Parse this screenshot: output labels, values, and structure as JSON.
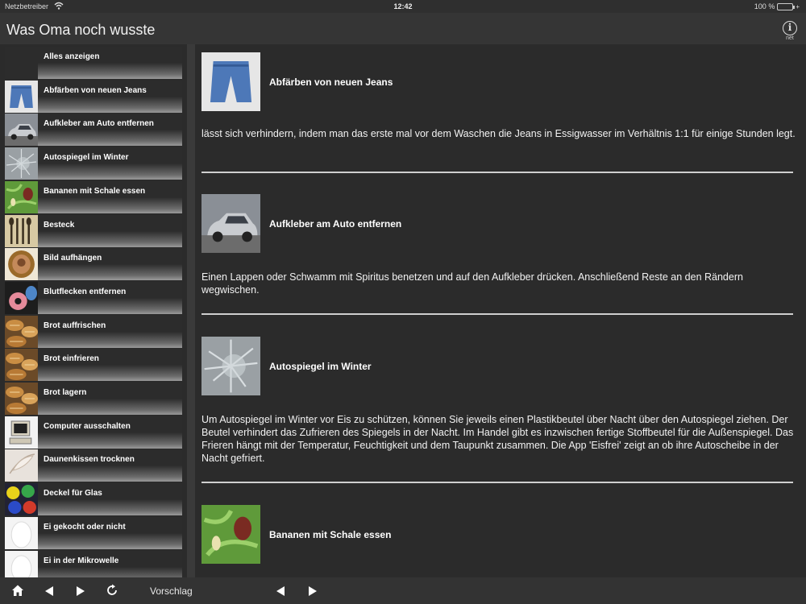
{
  "status": {
    "carrier": "Netzbetreiber",
    "time": "12:42",
    "battery": "100 %"
  },
  "header": {
    "title": "Was Oma noch wusste",
    "info_label": "net"
  },
  "sidebar": {
    "items": [
      {
        "label": "Alles anzeigen",
        "icon": "none"
      },
      {
        "label": "Abfärben von neuen Jeans",
        "icon": "jeans-photo"
      },
      {
        "label": "Aufkleber am Auto entfernen",
        "icon": "car-photo"
      },
      {
        "label": "Autospiegel im Winter",
        "icon": "frost-photo"
      },
      {
        "label": "Bananen mit Schale essen",
        "icon": "banana-photo"
      },
      {
        "label": "Besteck",
        "icon": "cutlery-photo"
      },
      {
        "label": "Bild aufhängen",
        "icon": "picture-frame-photo"
      },
      {
        "label": "Blutflecken entfernen",
        "icon": "sponge-photo"
      },
      {
        "label": "Brot auffrischen",
        "icon": "bread-photo"
      },
      {
        "label": "Brot einfrieren",
        "icon": "bread-photo"
      },
      {
        "label": "Brot lagern",
        "icon": "bread-photo"
      },
      {
        "label": "Computer ausschalten",
        "icon": "computer-photo"
      },
      {
        "label": "Daunenkissen trocknen",
        "icon": "feather-photo"
      },
      {
        "label": "Deckel für Glas",
        "icon": "glass-balls-photo"
      },
      {
        "label": "Ei gekocht oder nicht",
        "icon": "egg-photo"
      },
      {
        "label": "Ei in der Mikrowelle",
        "icon": "egg-photo"
      }
    ]
  },
  "main": {
    "entries": [
      {
        "title": "Abfärben von neuen Jeans",
        "image": "jeans-photo",
        "text": "lässt sich verhindern, indem man das erste mal vor dem Waschen die Jeans in Essigwasser im Verhältnis 1:1 für einige Stunden legt."
      },
      {
        "title": "Aufkleber am Auto entfernen",
        "image": "car-photo",
        "text": "Einen Lappen oder Schwamm mit Spiritus benetzen und auf den Aufkleber drücken. Anschließend Reste an den Rändern wegwischen."
      },
      {
        "title": "Autospiegel im Winter",
        "image": "frost-photo",
        "text": "Um Autospiegel im Winter vor Eis zu schützen, können Sie jeweils einen Plastikbeutel über Nacht über den Autospiegel ziehen. Der Beutel verhindert das Zufrieren des Spiegels in der Nacht. Im Handel gibt es inzwischen fertige Stoffbeutel für die Außenspiegel. Das Frieren hängt mit der Temperatur, Feuchtigkeit und dem Taupunkt zusammen. Die App 'Eisfrei' zeigt an ob ihre Autoscheibe in der Nacht gefriert."
      },
      {
        "title": "Bananen mit Schale essen",
        "image": "banana-photo",
        "text": ""
      }
    ]
  },
  "toolbar": {
    "suggestion_label": "Vorschlag"
  }
}
